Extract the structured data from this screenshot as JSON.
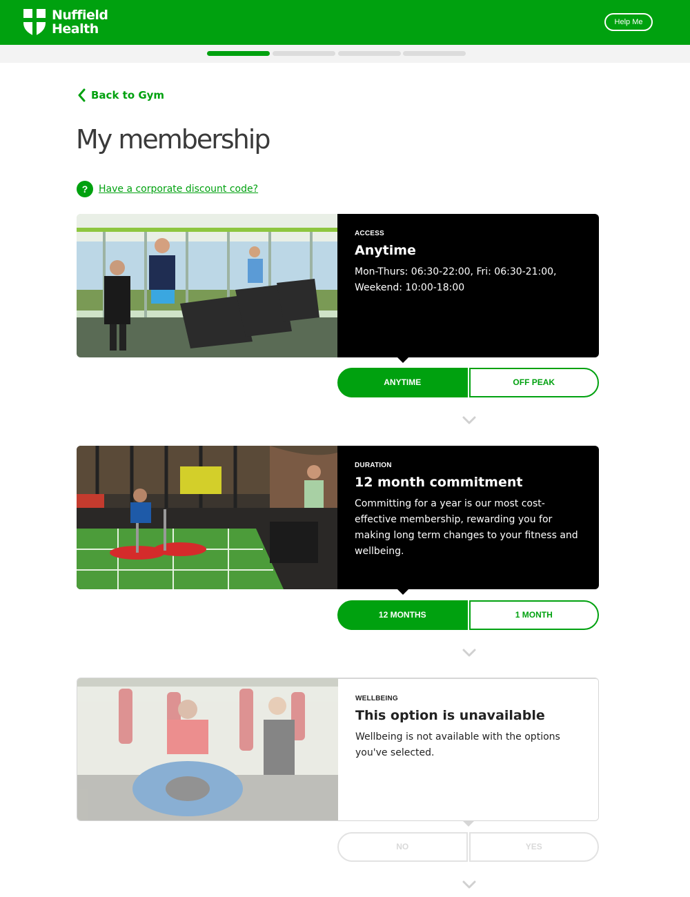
{
  "header": {
    "brand_line1": "Nuffield",
    "brand_line2": "Health",
    "help_label": "Help Me",
    "brand_color": "#00a10f"
  },
  "progress": {
    "steps_total": 4,
    "current_step": 1
  },
  "nav": {
    "back_label": "Back to Gym"
  },
  "page": {
    "title": "My membership"
  },
  "discount": {
    "icon": "?",
    "link_label": "Have a corporate discount code?"
  },
  "sections": [
    {
      "eyebrow": "ACCESS",
      "title": "Anytime",
      "description": "Mon-Thurs: 06:30-22:00, Fri: 06:30-21:00, Weekend: 10:00-18:00",
      "options": [
        {
          "label": "ANYTIME",
          "selected": true
        },
        {
          "label": "OFF PEAK",
          "selected": false
        }
      ]
    },
    {
      "eyebrow": "DURATION",
      "title": "12 month commitment",
      "description": "Committing for a year is our most cost-effective membership, rewarding you for making long term changes to your fitness and wellbeing.",
      "options": [
        {
          "label": "12 MONTHS",
          "selected": true
        },
        {
          "label": "1 MONTH",
          "selected": false
        }
      ]
    },
    {
      "eyebrow": "WELLBEING",
      "title": "This option is unavailable",
      "description": "Wellbeing is not available with the options you've selected.",
      "disabled": true,
      "options": [
        {
          "label": "NO",
          "selected": false
        },
        {
          "label": "YES",
          "selected": false
        }
      ]
    }
  ]
}
